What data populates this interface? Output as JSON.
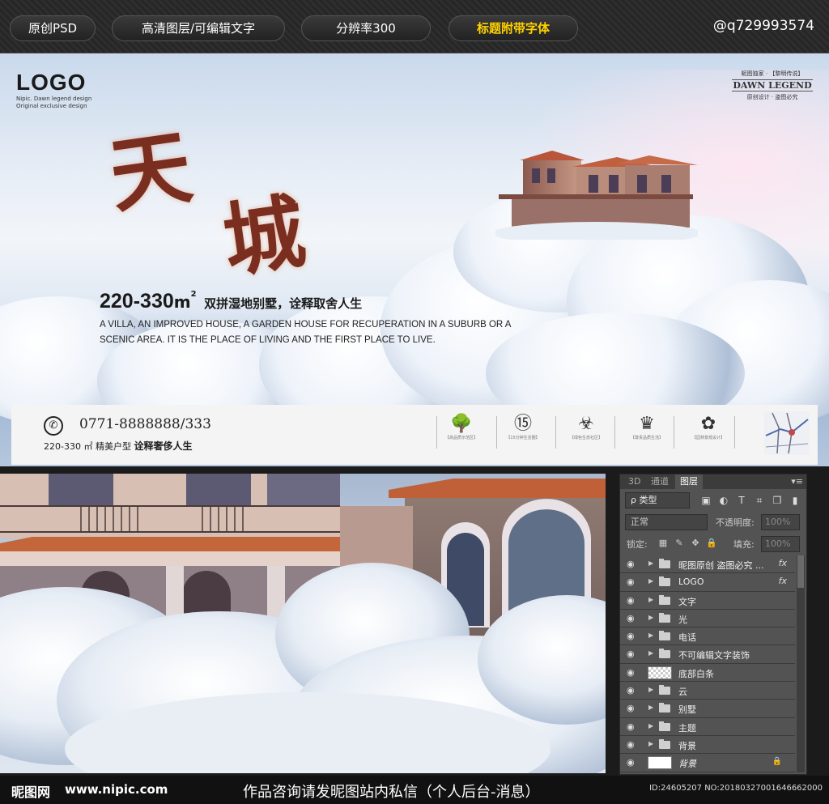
{
  "topbar": {
    "tags": [
      "原创PSD",
      "高清图层/可编辑文字",
      "分辨率300",
      "标题附带字体"
    ],
    "qq": "@q729993574"
  },
  "poster": {
    "logo": "LOGO",
    "logo_sub1": "Nipic. Dawn legend design",
    "logo_sub2": "Original exclusive design",
    "badge_top": "昵图独家 · 【黎明传说】",
    "badge_main": "DAWN LEGEND",
    "badge_bottom": "原创设计 · 盗图必究",
    "title_calligraphy": "天城",
    "area_number": "220-330",
    "area_unit": "m",
    "area_sup": "2",
    "area_desc": "双拼湿地别墅，诠释取舍人生",
    "english_copy": "A VILLA, AN IMPROVED HOUSE, A GARDEN HOUSE FOR RECUPERATION IN A SUBURB OR A SCENIC AREA. IT IS THE PLACE OF LIVING AND THE FIRST PLACE TO LIVE.",
    "phone": "0771-8888888/333",
    "phone_sub_prefix": "220-330 ㎡  精美户型",
    "phone_sub_bold": "诠释奢侈人生",
    "features": [
      {
        "icon": "tree-icon",
        "glyph": "🌳",
        "caption": "【高品质示范区】"
      },
      {
        "icon": "number-15-icon",
        "glyph": "⑮",
        "caption": "【15分钟生活圈】"
      },
      {
        "icon": "biohazard-icon",
        "glyph": "☣",
        "caption": "【绿色生态社区】"
      },
      {
        "icon": "crown-icon",
        "glyph": "♛",
        "caption": "【尊贵品质生活】"
      },
      {
        "icon": "flower-icon",
        "glyph": "✿",
        "caption": "【园林景观设计】"
      }
    ]
  },
  "ps_panel": {
    "tabs": [
      "3D",
      "通道",
      "图层"
    ],
    "menu_glyph": "▾≡",
    "kind_label": "ρ 类型",
    "blend_mode": "正常",
    "opacity_label": "不透明度:",
    "opacity_value": "100%",
    "lock_label": "锁定:",
    "fill_label": "填充:",
    "fill_value": "100%",
    "layers": [
      {
        "name": "昵图原创 盗图必究 ...",
        "type": "folder",
        "fx": "fx"
      },
      {
        "name": "LOGO",
        "type": "folder",
        "fx": "fx"
      },
      {
        "name": "文字",
        "type": "folder",
        "fx": ""
      },
      {
        "name": "光",
        "type": "folder",
        "fx": ""
      },
      {
        "name": "电话",
        "type": "folder",
        "fx": ""
      },
      {
        "name": "不可编辑文字装饰",
        "type": "folder",
        "fx": ""
      },
      {
        "name": "底部白条",
        "type": "checker",
        "fx": ""
      },
      {
        "name": "云",
        "type": "folder",
        "fx": ""
      },
      {
        "name": "别墅",
        "type": "folder",
        "fx": ""
      },
      {
        "name": "主题",
        "type": "folder",
        "fx": ""
      },
      {
        "name": "背景",
        "type": "folder",
        "fx": ""
      },
      {
        "name": "背景",
        "type": "white",
        "fx": ""
      }
    ]
  },
  "footer": {
    "logo": "昵图网",
    "url": "www.nipic.com",
    "message": "作品咨询请发昵图站内私信（个人后台-消息）",
    "id_text": "ID:24605207 NO:20180327001646662000"
  }
}
